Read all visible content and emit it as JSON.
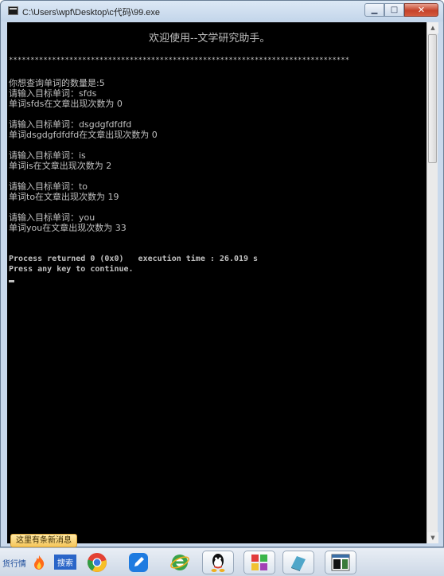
{
  "window": {
    "title": "C:\\Users\\wpf\\Desktop\\c代码\\99.exe",
    "minimize_glyph": "▁",
    "maximize_glyph": "□",
    "close_glyph": "✕"
  },
  "console": {
    "welcome": "欢迎使用--文学研究助手。",
    "stars": "*******************************************************************************",
    "lines": [
      "你想查询单词的数量是:5",
      "请输入目标单词：sfds",
      "单词sfds在文章出现次数为 0",
      "请输入目标单词：dsgdgfdfdfd",
      "单词dsgdgfdfdfd在文章出现次数为 0",
      "请输入目标单词：is",
      "单词is在文章出现次数为 2",
      "请输入目标单词：to",
      "单词to在文章出现次数为 19",
      "请输入目标单词：you",
      "单词you在文章出现次数为 33"
    ],
    "process_line": "Process returned 0 (0x0)   execution time : 26.019 s",
    "press_line": "Press any key to continue."
  },
  "notification": {
    "text": "这里有条新消息"
  },
  "taskbar": {
    "left_text": "货行情",
    "search_label": "搜索",
    "apps": [
      {
        "name": "fire-icon",
        "color": "#ff6a1a"
      },
      {
        "name": "chrome-icon",
        "color": "#e34133"
      },
      {
        "name": "pen-app-icon",
        "color": "#1e7be0"
      },
      {
        "name": "ie-icon",
        "color": "#3aa34a"
      },
      {
        "name": "qq-icon",
        "color": "#111111"
      },
      {
        "name": "codeblocks-icon",
        "color": "#a23fb5"
      },
      {
        "name": "notebook-icon",
        "color": "#4fa6c9"
      },
      {
        "name": "console-window-icon",
        "color": "#3a7a3a"
      }
    ]
  },
  "colors": {
    "console_bg": "#000000",
    "console_text": "#c0c0c0",
    "title_bg": "#c9d9ec",
    "close_red": "#c5422a",
    "taskbar_bg": "#dde5ef"
  }
}
